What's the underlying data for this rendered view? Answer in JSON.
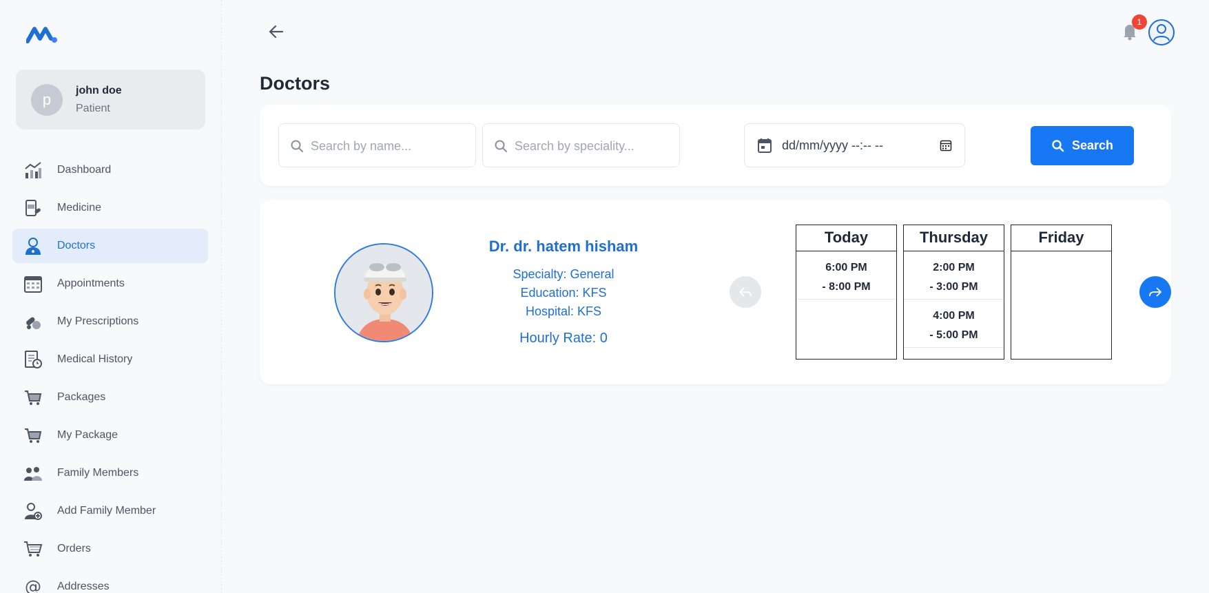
{
  "user": {
    "initial": "p",
    "name": "john doe",
    "role": "Patient"
  },
  "sidebar": {
    "items": [
      {
        "label": "Dashboard",
        "icon": "chart-icon"
      },
      {
        "label": "Medicine",
        "icon": "medicine-icon"
      },
      {
        "label": "Doctors",
        "icon": "doctor-icon",
        "active": true
      },
      {
        "label": "Appointments",
        "icon": "calendar-icon"
      },
      {
        "label": "My Prescriptions",
        "icon": "pills-icon"
      },
      {
        "label": "Medical History",
        "icon": "history-icon"
      },
      {
        "label": "Packages",
        "icon": "cart-icon"
      },
      {
        "label": "My Package",
        "icon": "cart-icon"
      },
      {
        "label": "Family Members",
        "icon": "family-icon"
      },
      {
        "label": "Add Family Member",
        "icon": "add-user-icon"
      },
      {
        "label": "Orders",
        "icon": "cart-icon"
      },
      {
        "label": "Addresses",
        "icon": "at-icon"
      }
    ]
  },
  "header": {
    "notification_count": "1"
  },
  "page": {
    "title": "Doctors"
  },
  "search": {
    "name_placeholder": "Search by name...",
    "speciality_placeholder": "Search by speciality...",
    "date_value": "dd/mm/yyyy --:-- --",
    "button_label": "Search"
  },
  "doctor": {
    "name": "Dr. dr. hatem hisham",
    "specialty": "Specialty: General",
    "education": "Education: KFS",
    "hospital": "Hospital: KFS",
    "rate": "Hourly Rate: 0"
  },
  "schedule": [
    {
      "day": "Today",
      "slots": [
        {
          "start": "6:00 PM",
          "end": "- 8:00 PM"
        }
      ]
    },
    {
      "day": "Thursday",
      "slots": [
        {
          "start": "2:00 PM",
          "end": "- 3:00 PM"
        },
        {
          "start": "4:00 PM",
          "end": "- 5:00 PM"
        }
      ]
    },
    {
      "day": "Friday",
      "slots": []
    }
  ],
  "colors": {
    "accent": "#1877f2",
    "text_blue": "#1f6fd1",
    "active_bg": "#e3ecfa",
    "badge": "#f04438"
  }
}
